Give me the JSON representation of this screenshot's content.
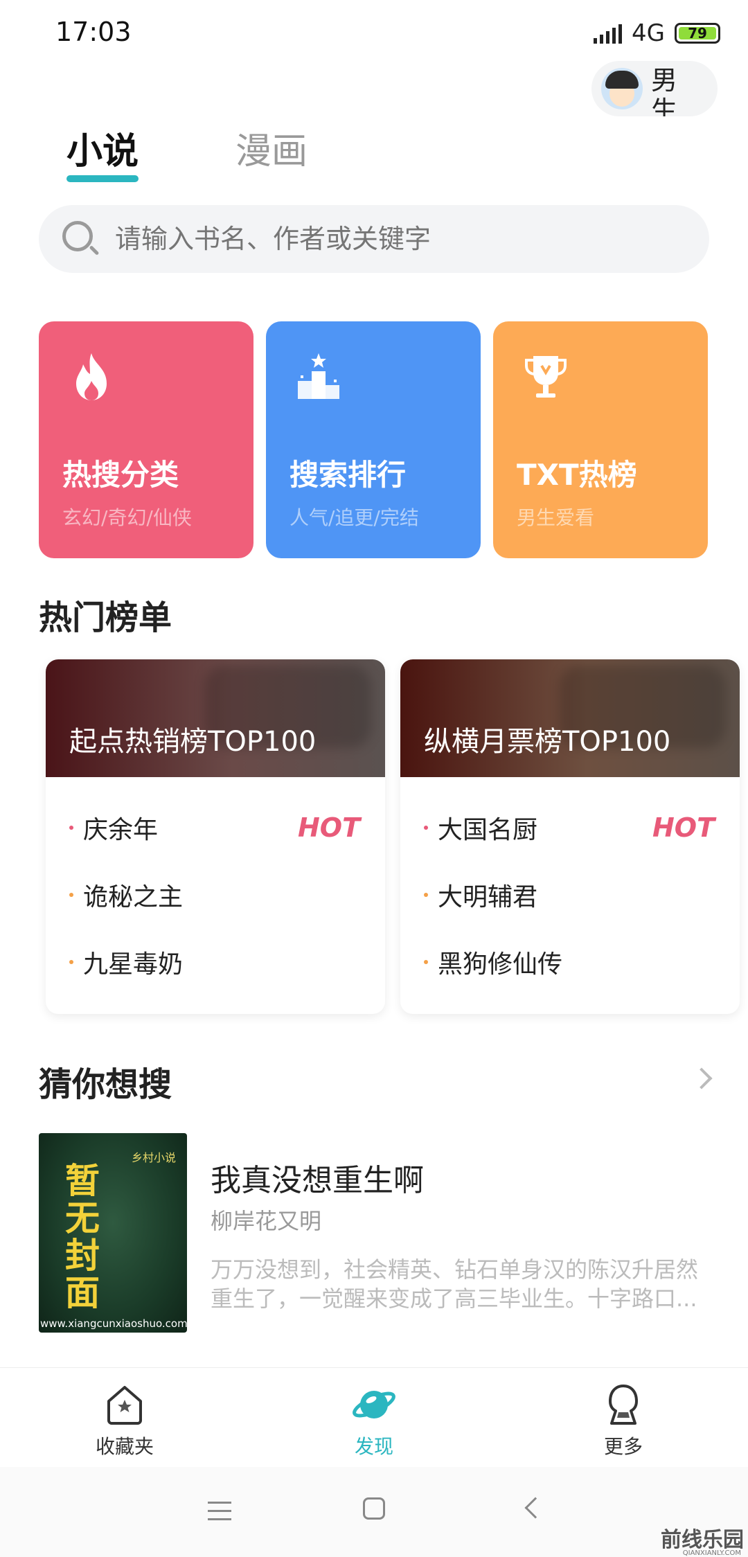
{
  "status_bar": {
    "time": "17:03",
    "network": "4G",
    "battery": "79"
  },
  "gender_switch": {
    "label": "男生"
  },
  "tabs": [
    {
      "label": "小说",
      "active": true
    },
    {
      "label": "漫画",
      "active": false
    }
  ],
  "search": {
    "placeholder": "请输入书名、作者或关键字"
  },
  "category_cards": [
    {
      "title": "热搜分类",
      "subtitle": "玄幻/奇幻/仙侠",
      "color": "#f05f7a",
      "icon": "flame-icon"
    },
    {
      "title": "搜索排行",
      "subtitle": "人气/追更/完结",
      "color": "#4f95f5",
      "icon": "podium-icon"
    },
    {
      "title": "TXT热榜",
      "subtitle": "男生爱看",
      "color": "#fdaa55",
      "icon": "trophy-icon"
    }
  ],
  "hot_rankings": {
    "title": "热门榜单",
    "boards": [
      {
        "title": "起点热销榜TOP100",
        "items": [
          "庆余年",
          "诡秘之主",
          "九星毒奶"
        ],
        "badge": "HOT"
      },
      {
        "title": "纵横月票榜TOP100",
        "items": [
          "大国名厨",
          "大明辅君",
          "黑狗修仙传"
        ],
        "badge": "HOT"
      }
    ]
  },
  "guess_search": {
    "title": "猜你想搜",
    "book": {
      "cover_tag": "乡村小说",
      "cover_text": "暂无封面",
      "cover_url": "www.xiangcunxiaoshuo.com",
      "title": "我真没想重生啊",
      "author": "柳岸花又明",
      "description": "万万没想到，社会精英、钻石单身汉的陈汉升居然重生了，一觉醒来变成了高三毕业生。十字路口..."
    }
  },
  "bottom_nav": [
    {
      "label": "收藏夹",
      "icon": "favorites-house-icon",
      "active": false
    },
    {
      "label": "发现",
      "icon": "planet-icon",
      "active": true
    },
    {
      "label": "更多",
      "icon": "more-person-icon",
      "active": false
    }
  ],
  "watermark": {
    "text": "前线乐园",
    "sub": "QIANXIANLY.COM"
  },
  "colors": {
    "accent": "#2bb6c0",
    "hot": "#e85a79",
    "dot": "#f4a047"
  }
}
